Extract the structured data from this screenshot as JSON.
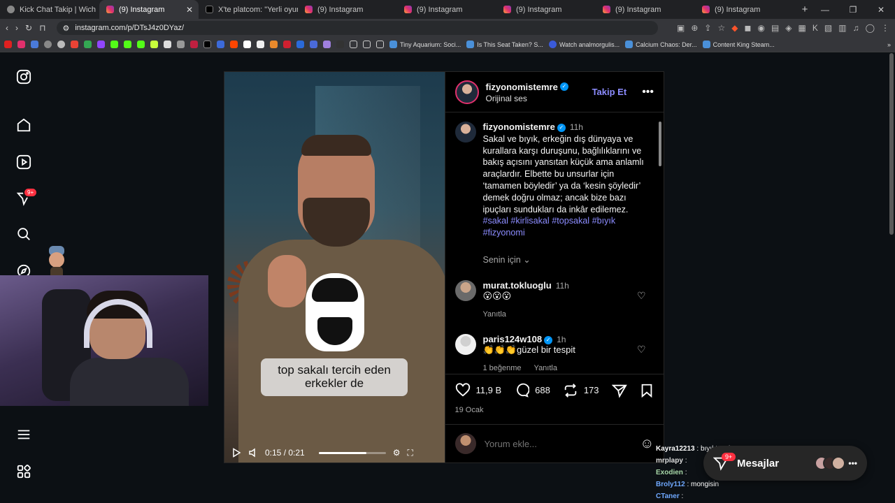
{
  "browser": {
    "tabs": [
      {
        "title": "Kick Chat Takip | Wich",
        "active": false,
        "favicon": "kick"
      },
      {
        "title": "(9) Instagram",
        "active": true,
        "favicon": "instagram"
      },
      {
        "title": "X'te platcom: \"Yerli oyun stüdy",
        "active": false,
        "favicon": "x"
      },
      {
        "title": "(9) Instagram",
        "active": false,
        "favicon": "instagram"
      },
      {
        "title": "(9) Instagram",
        "active": false,
        "favicon": "instagram"
      },
      {
        "title": "(9) Instagram",
        "active": false,
        "favicon": "instagram"
      },
      {
        "title": "(9) Instagram",
        "active": false,
        "favicon": "instagram"
      },
      {
        "title": "(9) Instagram",
        "active": false,
        "favicon": "instagram"
      }
    ],
    "url": "instagram.com/p/DTsJ4z0DYaz/",
    "bookmarks": [
      "Tiny Aquarium: Soci...",
      "Is This Seat Taken? S...",
      "Watch analmorgulis...",
      "Calcium Chaos: Der...",
      "Content King Steam..."
    ]
  },
  "nav": {
    "notification_badge": "9+"
  },
  "post": {
    "author": "fizyonomistemre",
    "audio": "Orijinal ses",
    "follow_label": "Takip Et",
    "caption_time": "11h",
    "caption": "Sakal ve bıyık, erkeğin dış dünyaya ve kurallara karşı duruşunu, bağlılıklarını ve bakış açısını yansıtan küçük ama anlamlı araçlardır. Elbette bu unsurlar için ‘tamamen böyledir’ ya da ‘kesin şöyledir’ demek doğru olmaz; ancak bize bazı ipuçları sundukları da inkâr edilemez.",
    "hashtags": "#sakal #kirlisakal #topsakal #bıyık #fizyonomi",
    "for_you": "Senin için",
    "video": {
      "subtitle_line1": "top sakalı tercih eden",
      "subtitle_line2": "erkekler de",
      "time": "0:15 / 0:21",
      "progress": 0.71
    },
    "comments": [
      {
        "user": "murat.tokluoglu",
        "time": "11h",
        "text": "😮😮😮",
        "reply": "Yanıtla",
        "likes": "",
        "verified": false
      },
      {
        "user": "paris124w108",
        "time": "1h",
        "text": "👏👏👏güzel bir tespit",
        "reply": "Yanıtla",
        "likes": "1 beğenme",
        "verified": true
      }
    ],
    "stats": {
      "likes": "11,9 B",
      "comments": "688",
      "reposts": "173"
    },
    "date": "19 Ocak",
    "add_comment_placeholder": "Yorum ekle..."
  },
  "messages": {
    "label": "Mesajlar",
    "badge": "9+"
  },
  "chat_overlay": [
    {
      "user": "Kayra12213",
      "text": ": bıyıkta çıkmıyo"
    },
    {
      "user": "mrplapy",
      "text": ":"
    },
    {
      "user": "Exodien",
      "text": ":"
    },
    {
      "user": "Broly112",
      "text": ": mongisin"
    },
    {
      "user": "CTaner",
      "text": ":"
    }
  ],
  "colors": {
    "background": "#0c1014",
    "accent_link": "#8c8cff",
    "verified": "#0095f6",
    "badge": "#ff3040"
  }
}
